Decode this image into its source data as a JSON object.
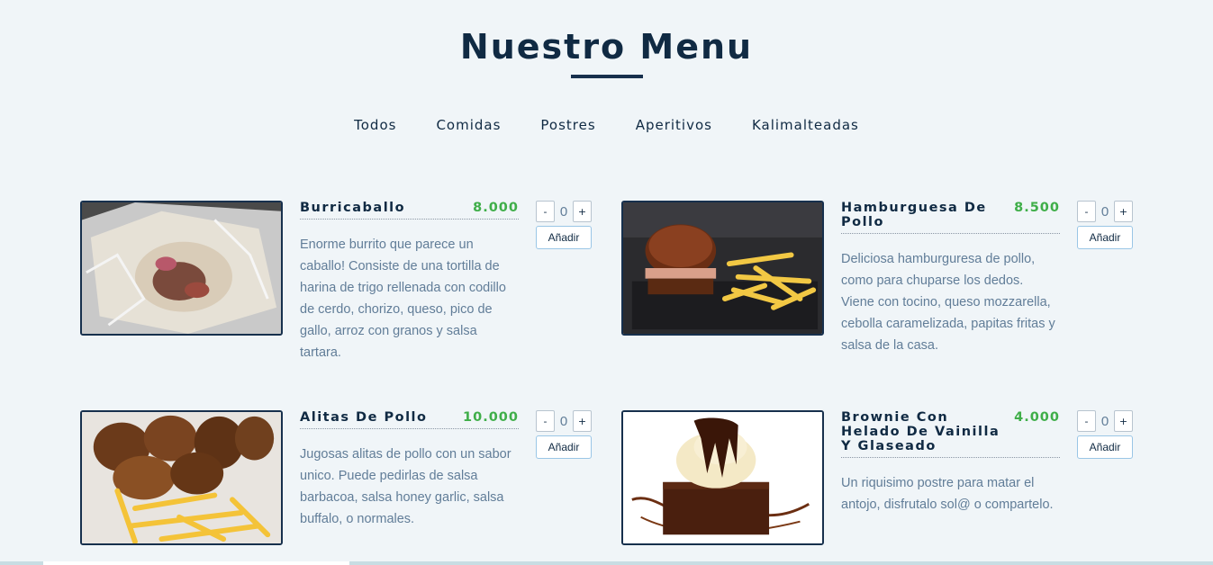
{
  "header": {
    "title": "Nuestro Menu"
  },
  "filters": [
    "Todos",
    "Comidas",
    "Postres",
    "Aperitivos",
    "Kalimalteadas"
  ],
  "controls": {
    "minus": "-",
    "plus": "+",
    "add_label": "Añadir"
  },
  "items": [
    {
      "name": "Burricaballo",
      "price": "8.000",
      "qty": "0",
      "image": "burrito-photo",
      "desc": "Enorme burrito que parece un caballo! Consiste de una tortilla de harina de trigo rellenada con codillo de cerdo, chorizo, queso, pico de gallo, arroz con granos y salsa tartara."
    },
    {
      "name": "Hamburguesa De Pollo",
      "price": "8.500",
      "qty": "0",
      "image": "chicken-burger-photo",
      "desc": "Deliciosa hamburguresa de pollo, como para chuparse los dedos. Viene con tocino, queso mozzarella, cebolla caramelizada, papitas fritas y salsa de la casa."
    },
    {
      "name": "Alitas De Pollo",
      "price": "10.000",
      "qty": "0",
      "image": "chicken-wings-photo",
      "desc": "Jugosas alitas de pollo con un sabor unico. Puede pedirlas de salsa barbacoa, salsa honey garlic, salsa buffalo, o normales."
    },
    {
      "name": "Brownie Con Helado De Vainilla Y Glaseado",
      "price": "4.000",
      "qty": "0",
      "image": "brownie-photo",
      "desc": "Un riquisimo postre para matar el antojo, disfrutalo sol@ o compartelo."
    }
  ]
}
